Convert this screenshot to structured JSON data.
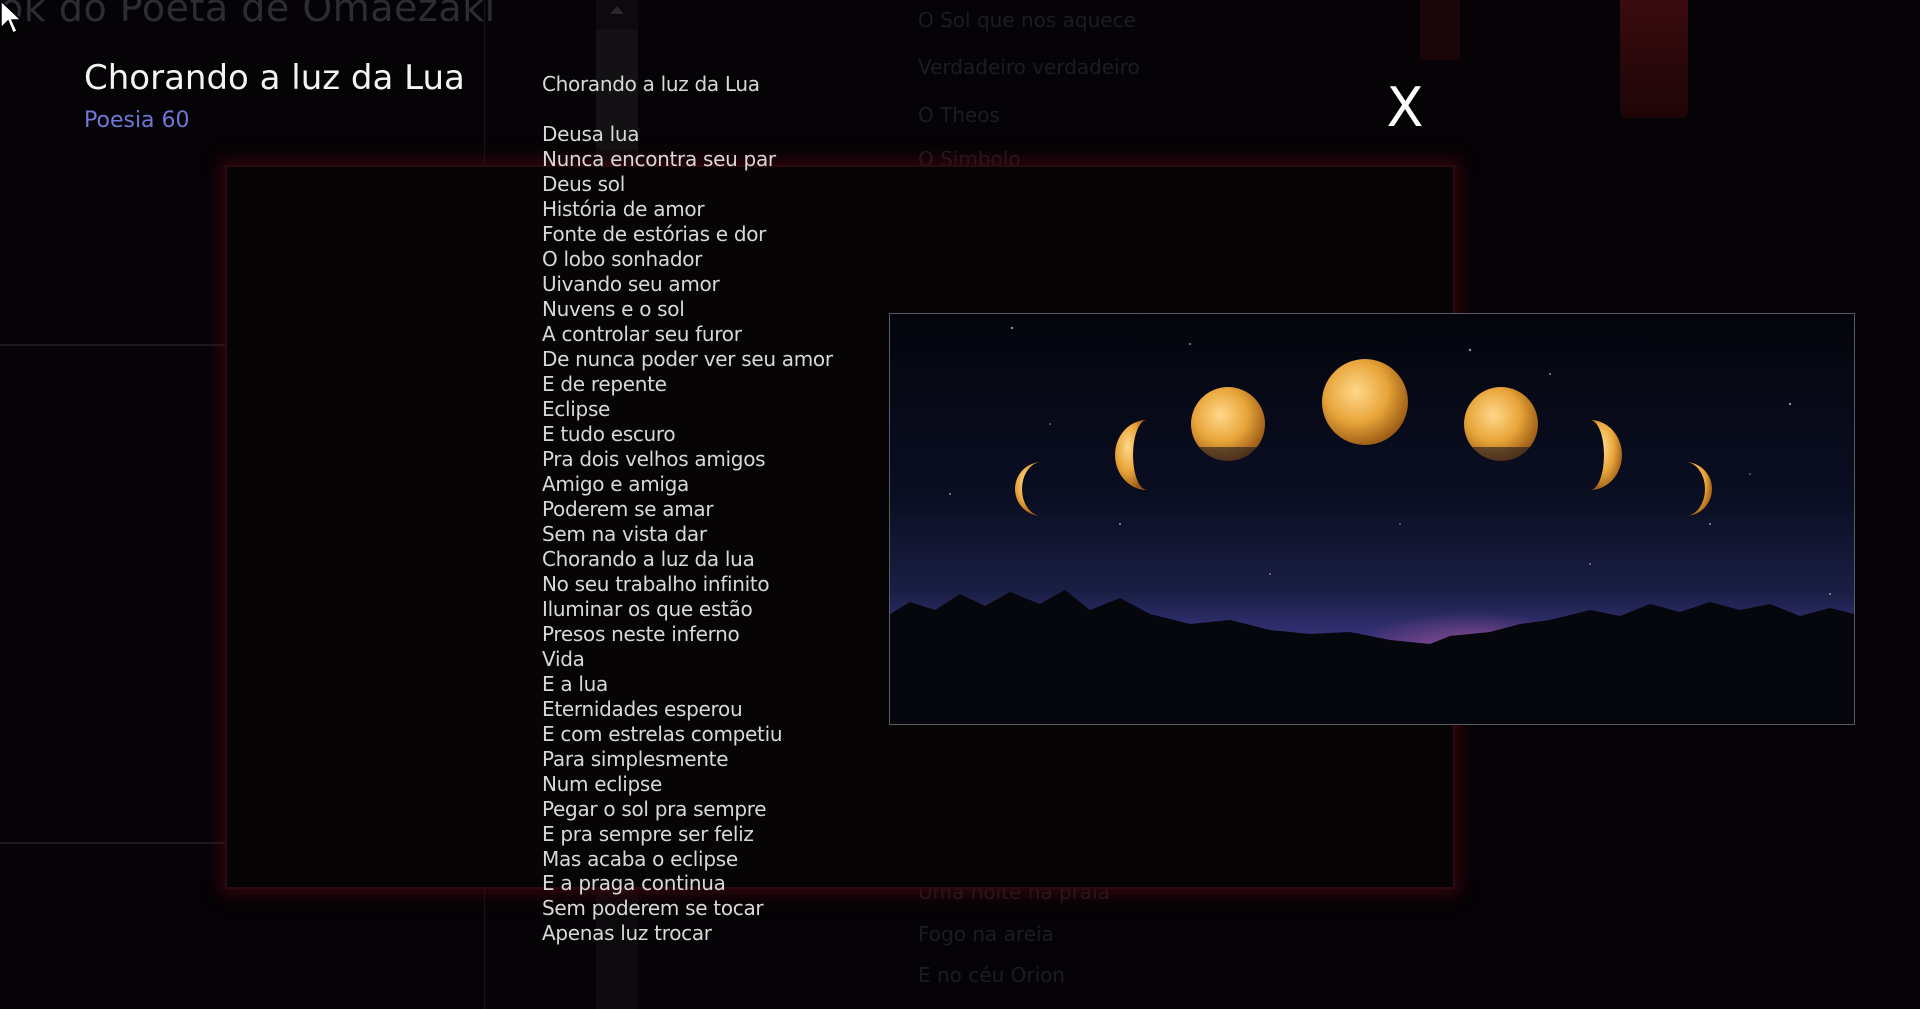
{
  "background": {
    "site_title": "ok do Poeta de Omaezaki",
    "poem_list_top": [
      "O Sol que nos aquece",
      "Verdadeiro  verdadeiro",
      "O Theos",
      "O Simbolo"
    ],
    "poem_list_bottom": [
      "Uma noite na praia",
      "Fogo na areia",
      "E no céu Orion"
    ]
  },
  "poem": {
    "title": "Chorando a luz da Lua",
    "subtitle": "Poesia 60",
    "heading": "Chorando a luz da Lua",
    "lines": [
      "Deusa lua",
      "Nunca encontra seu par",
      "Deus sol",
      "História de amor",
      "Fonte de estórias e dor",
      "O lobo sonhador",
      "Uivando seu amor",
      "Nuvens e o sol",
      "A controlar seu furor",
      "De nunca poder ver seu amor",
      "E de repente",
      "Eclipse",
      "E tudo escuro",
      "Pra dois velhos amigos",
      "Amigo e amiga",
      "Poderem se amar",
      "Sem na vista dar",
      "Chorando a luz da lua",
      "No seu trabalho infinito",
      "Iluminar os que estão",
      "Presos neste inferno",
      "Vida",
      "E a lua",
      "Eternidades esperou",
      "E com estrelas competiu",
      "Para simplesmente",
      "Num eclipse",
      "Pegar o sol pra sempre",
      "E pra sempre ser feliz",
      "Mas acaba o eclipse",
      "E a praga continua",
      "Sem poderem se tocar",
      "Apenas luz trocar"
    ]
  },
  "close_label": "X",
  "colors": {
    "accent_subtitle": "#6f77d6",
    "frame_glow": "#55080e",
    "moon": "#e8a53a"
  },
  "icons": {
    "cursor": "mouse-pointer-icon",
    "close": "close-icon"
  }
}
